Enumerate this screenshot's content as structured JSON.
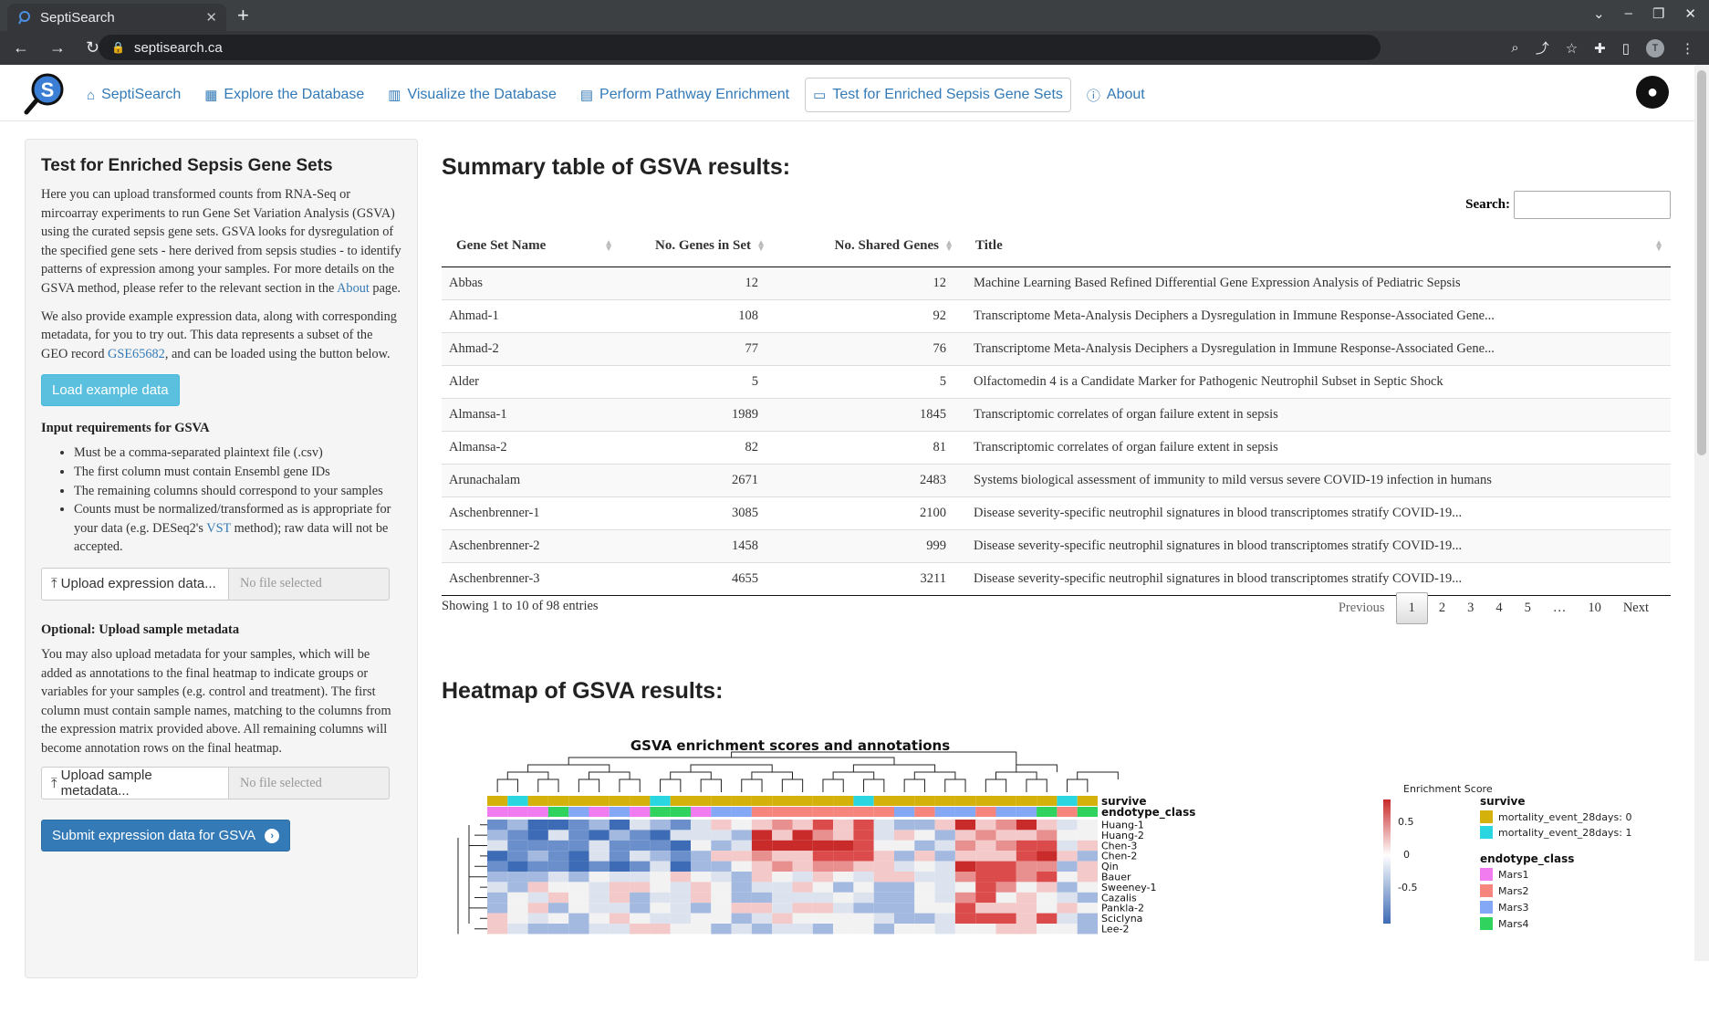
{
  "browser": {
    "tab_title": "SeptiSearch",
    "url": "septisearch.ca",
    "avatar_letter": "T"
  },
  "navbar": {
    "items": [
      {
        "label": "SeptiSearch",
        "icon": "home-icon"
      },
      {
        "label": "Explore the Database",
        "icon": "table-icon"
      },
      {
        "label": "Visualize the Database",
        "icon": "chart-icon"
      },
      {
        "label": "Perform Pathway Enrichment",
        "icon": "clipboard-icon"
      },
      {
        "label": "Test for Enriched Sepsis Gene Sets",
        "icon": "presentation-icon"
      },
      {
        "label": "About",
        "icon": "info-icon"
      }
    ]
  },
  "sidebar": {
    "title": "Test for Enriched Sepsis Gene Sets",
    "intro_1": "Here you can upload transformed counts from RNA-Seq or mircoarray experiments to run Gene Set Variation Analysis (GSVA) using the curated sepsis gene sets. GSVA looks for dysregulation of the specified gene sets - here derived from sepsis studies - to identify patterns of expression among your samples. For more details on the GSVA method, please refer to the relevant section in the ",
    "intro_link": "About",
    "intro_end": " page.",
    "example_1": "We also provide example expression data, along with corresponding metadata, for you to try out. This data represents a subset of the GEO record ",
    "example_link": "GSE65682",
    "example_end": ", and can be loaded using the button below.",
    "load_button": "Load example data",
    "req_title": "Input requirements for GSVA",
    "req_1": "Must be a comma-separated plaintext file (.csv)",
    "req_2": "The first column must contain Ensembl gene IDs",
    "req_3": "The remaining columns should correspond to your samples",
    "req_4a": "Counts must be normalized/transformed as is appropriate for your data (e.g. DESeq2's ",
    "req_4_link": "VST",
    "req_4b": " method); raw data will not be accepted.",
    "upload_expr_label": "Upload expression data...",
    "upload_expr_file": "No file selected",
    "meta_title": "Optional: Upload sample metadata",
    "meta_text": "You may also upload metadata for your samples, which will be added as annotations to the final heatmap to indicate groups or variables for your samples (e.g. control and treatment). The first column must contain sample names, matching to the columns from the expression matrix provided above. All remaining columns will become annotation rows on the final heatmap.",
    "upload_meta_label": "Upload sample metadata...",
    "upload_meta_file": "No file selected",
    "submit_button": "Submit expression data for GSVA"
  },
  "main": {
    "summary_title": "Summary table of GSVA results:",
    "search_label": "Search:",
    "columns": [
      "Gene Set Name",
      "No. Genes in Set",
      "No. Shared Genes",
      "Title"
    ],
    "rows": [
      [
        "Abbas",
        "12",
        "12",
        "Machine Learning Based Refined Differential Gene Expression Analysis of Pediatric Sepsis"
      ],
      [
        "Ahmad-1",
        "108",
        "92",
        "Transcriptome Meta-Analysis Deciphers a Dysregulation in Immune Response-Associated Gene..."
      ],
      [
        "Ahmad-2",
        "77",
        "76",
        "Transcriptome Meta-Analysis Deciphers a Dysregulation in Immune Response-Associated Gene..."
      ],
      [
        "Alder",
        "5",
        "5",
        "Olfactomedin 4 is a Candidate Marker for Pathogenic Neutrophil Subset in Septic Shock"
      ],
      [
        "Almansa-1",
        "1989",
        "1845",
        "Transcriptomic correlates of organ failure extent in sepsis"
      ],
      [
        "Almansa-2",
        "82",
        "81",
        "Transcriptomic correlates of organ failure extent in sepsis"
      ],
      [
        "Arunachalam",
        "2671",
        "2483",
        "Systems biological assessment of immunity to mild versus severe COVID-19 infection in humans"
      ],
      [
        "Aschenbrenner-1",
        "3085",
        "2100",
        "Disease severity-specific neutrophil signatures in blood transcriptomes stratify COVID-19..."
      ],
      [
        "Aschenbrenner-2",
        "1458",
        "999",
        "Disease severity-specific neutrophil signatures in blood transcriptomes stratify COVID-19..."
      ],
      [
        "Aschenbrenner-3",
        "4655",
        "3211",
        "Disease severity-specific neutrophil signatures in blood transcriptomes stratify COVID-19..."
      ]
    ],
    "table_info": "Showing 1 to 10 of 98 entries",
    "pager": {
      "previous": "Previous",
      "pages": [
        "1",
        "2",
        "3",
        "4",
        "5",
        "…",
        "10"
      ],
      "next": "Next"
    },
    "heatmap_title": "Heatmap of GSVA results:"
  },
  "heatmap": {
    "plot_title": "GSVA enrichment scores and annotations",
    "annotation_rows": [
      "survive",
      "endotype_class"
    ],
    "gene_sets": [
      "Huang-1",
      "Huang-2",
      "Chen-3",
      "Chen-2",
      "Qin",
      "Bauer",
      "Sweeney-1",
      "Cazalis",
      "Pankla-2",
      "Sciclуna",
      "Lee-2"
    ],
    "legend_score_title": "Enrichment Score",
    "legend_score_ticks": [
      "0.5",
      "0",
      "-0.5"
    ],
    "legend_survive_title": "survive",
    "legend_survive_items": [
      {
        "label": "mortality_event_28days: 0",
        "color": "#d4b10b"
      },
      {
        "label": "mortality_event_28days: 1",
        "color": "#2ad7e0"
      }
    ],
    "legend_endotype_title": "endotype_class",
    "legend_endotype_items": [
      {
        "label": "Mars1",
        "color": "#f07cf0"
      },
      {
        "label": "Mars2",
        "color": "#f6857d"
      },
      {
        "label": "Mars3",
        "color": "#84a8f5"
      },
      {
        "label": "Mars4",
        "color": "#2fd35d"
      }
    ],
    "survive_colors": [
      "y",
      "c",
      "y",
      "y",
      "y",
      "y",
      "y",
      "y",
      "c",
      "y",
      "y",
      "y",
      "y",
      "y",
      "y",
      "y",
      "y",
      "y",
      "c",
      "y",
      "y",
      "y",
      "y",
      "y",
      "y",
      "y",
      "y",
      "y",
      "c",
      "y"
    ],
    "endotype_colors": [
      "1",
      "1",
      "1",
      "4",
      "3",
      "1",
      "3",
      "1",
      "4",
      "4",
      "1",
      "3",
      "3",
      "2",
      "2",
      "2",
      "2",
      "2",
      "2",
      "2",
      "3",
      "2",
      "3",
      "3",
      "2",
      "3",
      "3",
      "4",
      "2",
      "4"
    ]
  }
}
